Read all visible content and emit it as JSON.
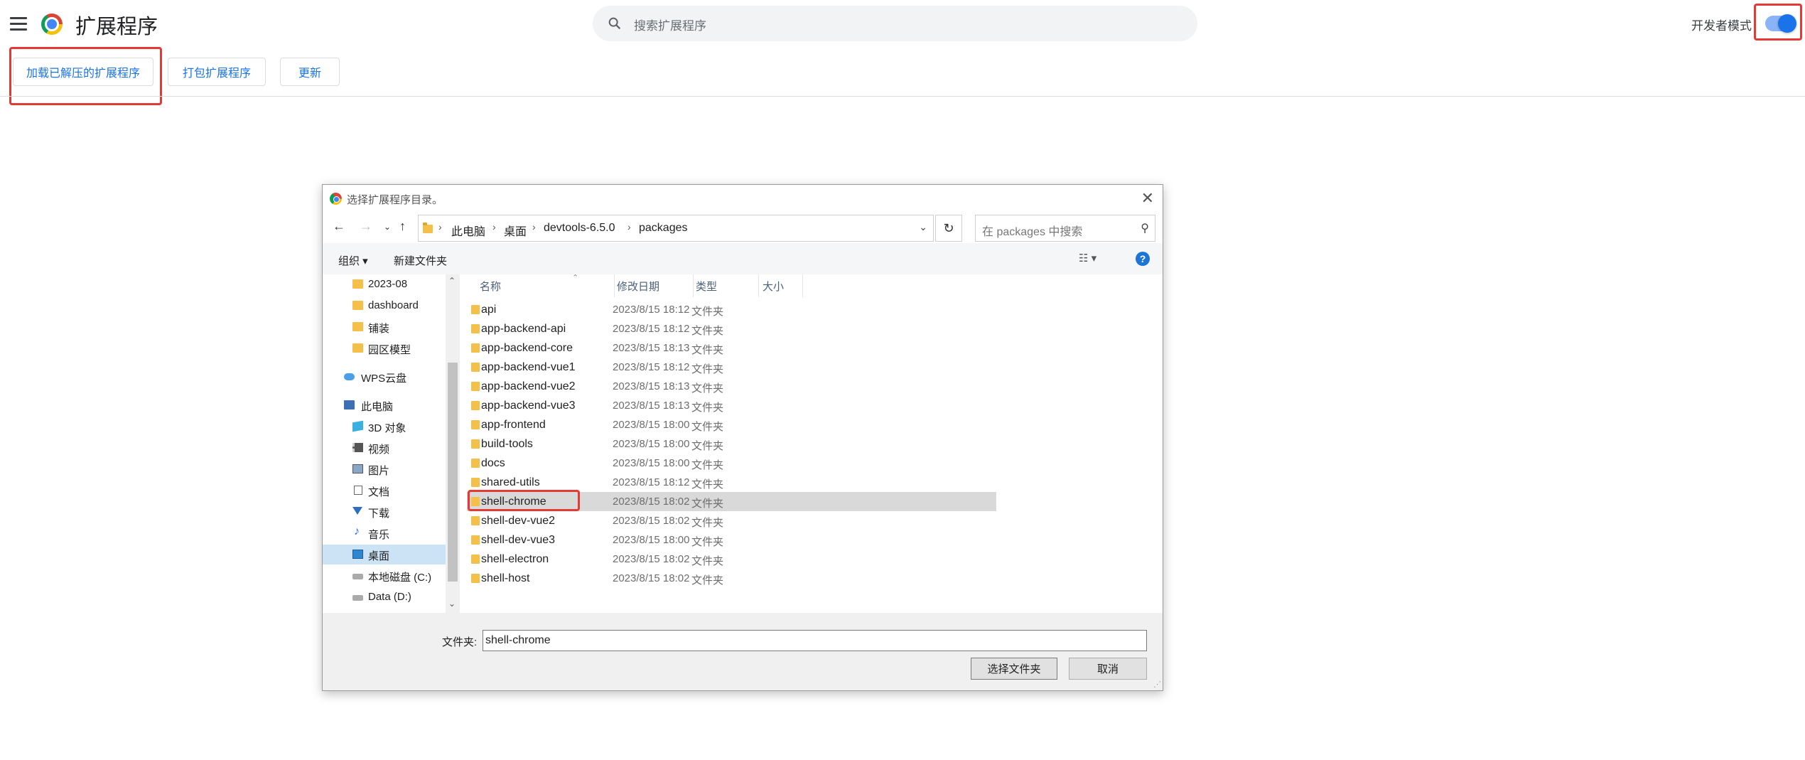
{
  "header": {
    "title": "扩展程序",
    "search_placeholder": "搜索扩展程序",
    "devmode_label": "开发者模式",
    "devmode_on": true
  },
  "toolbar": {
    "load_unpacked": "加载已解压的扩展程序",
    "pack": "打包扩展程序",
    "update": "更新"
  },
  "dialog": {
    "title": "选择扩展程序目录。",
    "breadcrumbs": [
      "此电脑",
      "桌面",
      "devtools-6.5.0",
      "packages"
    ],
    "search_placeholder": "在 packages 中搜索",
    "organize": "组织 ▾",
    "new_folder": "新建文件夹",
    "help": "?",
    "nav_items": [
      {
        "label": "2023-08",
        "icon": "folder-icon"
      },
      {
        "label": "dashboard",
        "icon": "folder-icon"
      },
      {
        "label": "铺装",
        "icon": "folder-icon"
      },
      {
        "label": "园区模型",
        "icon": "folder-icon"
      },
      {
        "label": "WPS云盘",
        "icon": "cloud-icon"
      },
      {
        "label": "此电脑",
        "icon": "computer-icon"
      },
      {
        "label": "3D 对象",
        "icon": "3d-objects-icon"
      },
      {
        "label": "视频",
        "icon": "video-icon"
      },
      {
        "label": "图片",
        "icon": "pictures-icon"
      },
      {
        "label": "文档",
        "icon": "documents-icon"
      },
      {
        "label": "下载",
        "icon": "download-icon"
      },
      {
        "label": "音乐",
        "icon": "music-icon"
      },
      {
        "label": "桌面",
        "icon": "desktop-icon",
        "selected": true
      },
      {
        "label": "本地磁盘 (C:)",
        "icon": "drive-icon"
      },
      {
        "label": "Data (D:)",
        "icon": "drive-icon"
      }
    ],
    "columns": {
      "name": "名称",
      "modified": "修改日期",
      "type": "类型",
      "size": "大小"
    },
    "files": [
      {
        "name": "api",
        "date": "2023/8/15 18:12",
        "type": "文件夹"
      },
      {
        "name": "app-backend-api",
        "date": "2023/8/15 18:12",
        "type": "文件夹"
      },
      {
        "name": "app-backend-core",
        "date": "2023/8/15 18:13",
        "type": "文件夹"
      },
      {
        "name": "app-backend-vue1",
        "date": "2023/8/15 18:12",
        "type": "文件夹"
      },
      {
        "name": "app-backend-vue2",
        "date": "2023/8/15 18:13",
        "type": "文件夹"
      },
      {
        "name": "app-backend-vue3",
        "date": "2023/8/15 18:13",
        "type": "文件夹"
      },
      {
        "name": "app-frontend",
        "date": "2023/8/15 18:00",
        "type": "文件夹"
      },
      {
        "name": "build-tools",
        "date": "2023/8/15 18:00",
        "type": "文件夹"
      },
      {
        "name": "docs",
        "date": "2023/8/15 18:00",
        "type": "文件夹"
      },
      {
        "name": "shared-utils",
        "date": "2023/8/15 18:12",
        "type": "文件夹"
      },
      {
        "name": "shell-chrome",
        "date": "2023/8/15 18:02",
        "type": "文件夹",
        "selected": true
      },
      {
        "name": "shell-dev-vue2",
        "date": "2023/8/15 18:02",
        "type": "文件夹"
      },
      {
        "name": "shell-dev-vue3",
        "date": "2023/8/15 18:00",
        "type": "文件夹"
      },
      {
        "name": "shell-electron",
        "date": "2023/8/15 18:02",
        "type": "文件夹"
      },
      {
        "name": "shell-host",
        "date": "2023/8/15 18:02",
        "type": "文件夹"
      }
    ],
    "folder_label": "文件夹:",
    "folder_value": "shell-chrome",
    "select_button": "选择文件夹",
    "cancel_button": "取消"
  },
  "colors": {
    "accent": "#1a73e8",
    "highlight_box": "#e53935"
  }
}
